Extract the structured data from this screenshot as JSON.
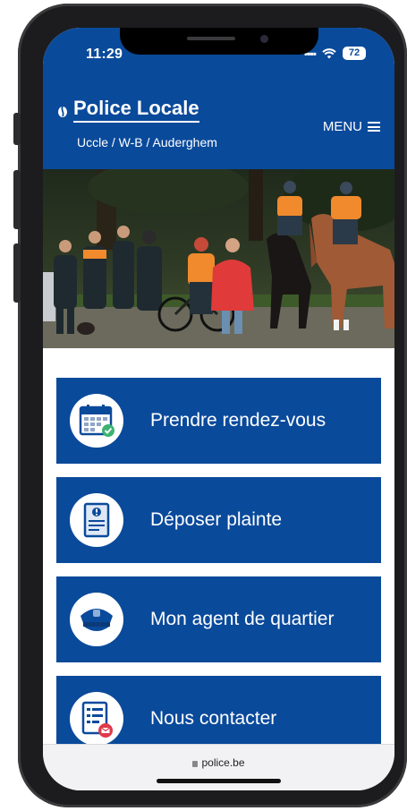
{
  "status_bar": {
    "time": "11:29",
    "battery": "72"
  },
  "header": {
    "title": "Police Locale",
    "subtitle": "Uccle / W-B / Auderghem",
    "menu_label": "MENU"
  },
  "actions": [
    {
      "label": "Prendre rendez-vous",
      "icon": "calendar-check-icon"
    },
    {
      "label": "Déposer plainte",
      "icon": "complaint-document-icon"
    },
    {
      "label": "Mon agent de quartier",
      "icon": "police-cap-icon"
    },
    {
      "label": "Nous contacter",
      "icon": "contact-form-icon"
    }
  ],
  "browser": {
    "url": "police.be"
  },
  "colors": {
    "brand": "#0a4a9b",
    "accent_orange": "#f08a2c",
    "check_green": "#3cb371",
    "mail_red": "#e03a4a"
  }
}
